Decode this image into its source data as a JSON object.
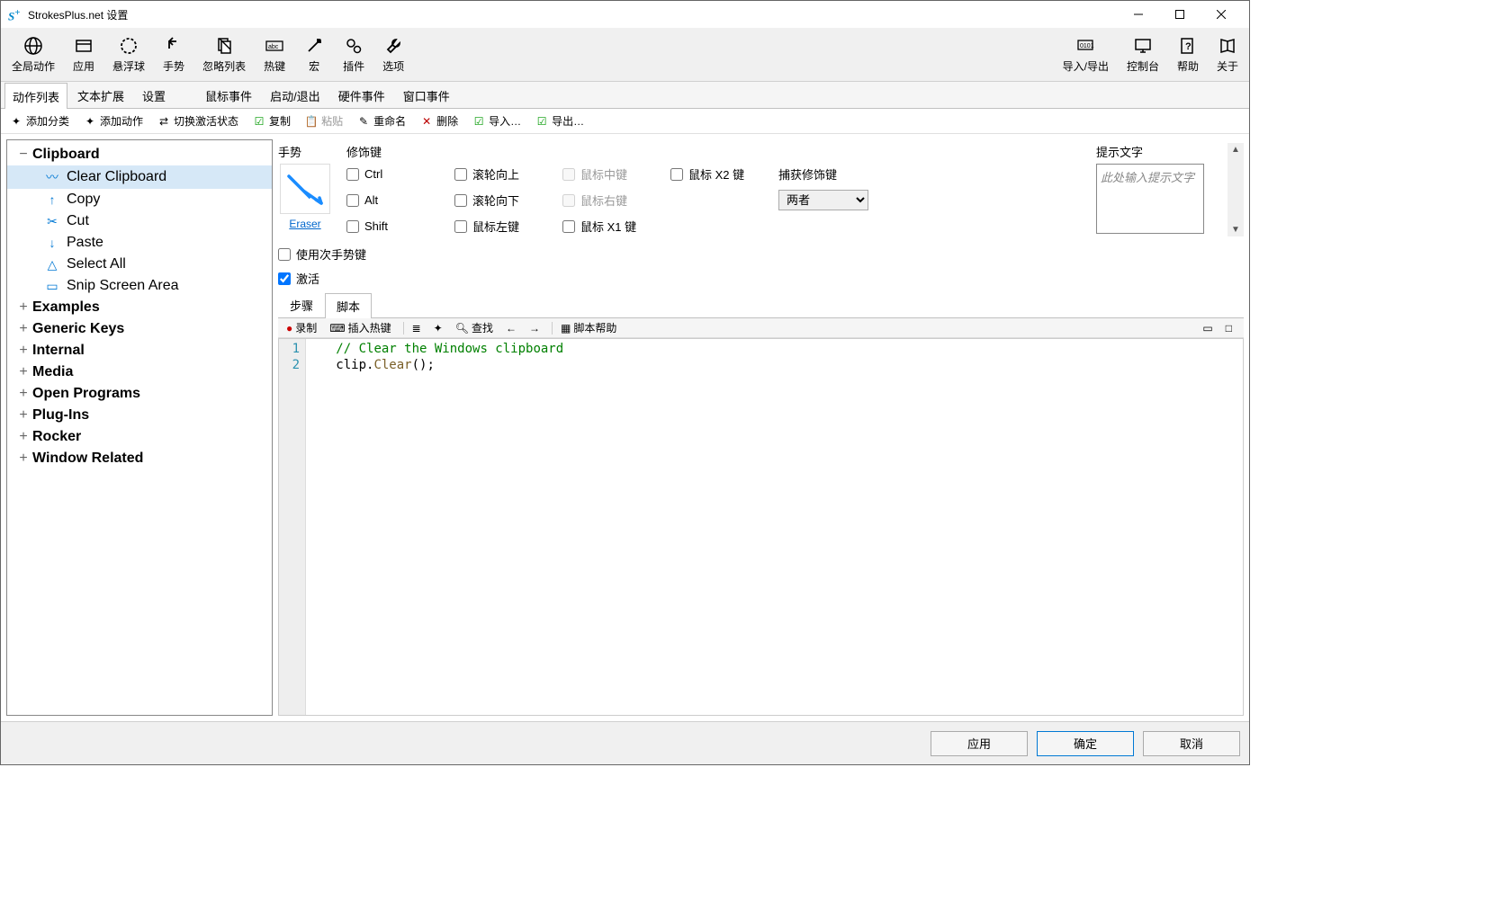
{
  "window": {
    "title": "StrokesPlus.net 设置"
  },
  "ribbon": {
    "left": [
      {
        "id": "global-actions",
        "label": "全局动作",
        "icon": "globe"
      },
      {
        "id": "applications",
        "label": "应用",
        "icon": "window"
      },
      {
        "id": "floater",
        "label": "悬浮球",
        "icon": "circle-dashed"
      },
      {
        "id": "gestures",
        "label": "手势",
        "icon": "undo"
      },
      {
        "id": "ignore-list",
        "label": "忽略列表",
        "icon": "docs"
      },
      {
        "id": "hotkeys",
        "label": "热键",
        "icon": "abc"
      },
      {
        "id": "macros",
        "label": "宏",
        "icon": "wand"
      },
      {
        "id": "plugins",
        "label": "插件",
        "icon": "gears"
      },
      {
        "id": "options",
        "label": "选项",
        "icon": "wrench"
      }
    ],
    "right": [
      {
        "id": "import-export",
        "label": "导入/导出",
        "icon": "binary"
      },
      {
        "id": "console",
        "label": "控制台",
        "icon": "monitor"
      },
      {
        "id": "help",
        "label": "帮助",
        "icon": "help"
      },
      {
        "id": "about",
        "label": "关于",
        "icon": "book"
      }
    ]
  },
  "sub_tabs": [
    "动作列表",
    "文本扩展",
    "设置",
    "鼠标事件",
    "启动/退出",
    "硬件事件",
    "窗口事件"
  ],
  "sub_tabs_active": 0,
  "actions": {
    "add_category": "添加分类",
    "add_action": "添加动作",
    "toggle_active": "切换激活状态",
    "copy": "复制",
    "paste": "粘贴",
    "rename": "重命名",
    "delete": "删除",
    "import": "导入…",
    "export": "导出…"
  },
  "tree": {
    "categories": [
      {
        "name": "Clipboard",
        "expanded": true,
        "items": [
          {
            "name": "Clear Clipboard",
            "icon": "scribble",
            "selected": true
          },
          {
            "name": "Copy",
            "icon": "arrow-up"
          },
          {
            "name": "Cut",
            "icon": "scissors"
          },
          {
            "name": "Paste",
            "icon": "arrow-down"
          },
          {
            "name": "Select All",
            "icon": "triangle"
          },
          {
            "name": "Snip Screen Area",
            "icon": "rect"
          }
        ]
      },
      {
        "name": "Examples",
        "expanded": false
      },
      {
        "name": "Generic Keys",
        "expanded": false
      },
      {
        "name": "Internal",
        "expanded": false
      },
      {
        "name": "Media",
        "expanded": false
      },
      {
        "name": "Open Programs",
        "expanded": false
      },
      {
        "name": "Plug-Ins",
        "expanded": false
      },
      {
        "name": "Rocker",
        "expanded": false
      },
      {
        "name": "Window Related",
        "expanded": false
      }
    ]
  },
  "detail": {
    "gesture_label": "手势",
    "gesture_name": "Eraser",
    "modifiers_label": "修饰键",
    "mods": {
      "ctrl": "Ctrl",
      "alt": "Alt",
      "shift": "Shift",
      "wheel_up": "滚轮向上",
      "wheel_down": "滚轮向下",
      "mouse_left": "鼠标左键",
      "mouse_middle": "鼠标中键",
      "mouse_right": "鼠标右键",
      "mouse_x1": "鼠标 X1 键",
      "mouse_x2": "鼠标 X2 键"
    },
    "capture_label": "捕获修饰键",
    "capture_value": "两者",
    "hint_label": "提示文字",
    "hint_placeholder": "此处输入提示文字",
    "use_secondary": "使用次手势键",
    "active": "激活",
    "sub2_tabs": [
      "步骤",
      "脚本"
    ],
    "sub2_active": 1,
    "script_bar": {
      "record": "录制",
      "insert_hotkey": "插入热键",
      "find": "查找",
      "script_help": "脚本帮助"
    },
    "code": {
      "lines": [
        {
          "n": 1,
          "html": "<span class='c-comment'>// Clear the Windows clipboard</span>"
        },
        {
          "n": 2,
          "html": "<span class='c-ident'>clip.</span><span class='c-method'>Clear</span><span class='c-ident'>();</span>"
        }
      ]
    }
  },
  "footer": {
    "apply": "应用",
    "ok": "确定",
    "cancel": "取消"
  }
}
